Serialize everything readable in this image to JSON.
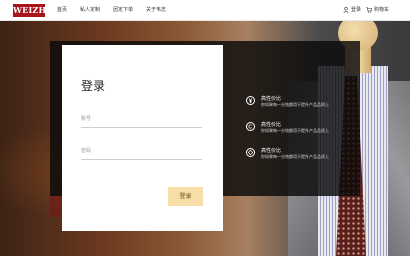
{
  "brand": {
    "logo_text": "WEIZHI"
  },
  "nav": {
    "items": [
      {
        "label": "首页"
      },
      {
        "label": "私人定制"
      },
      {
        "label": "团定下单"
      },
      {
        "label": "关于韦志"
      }
    ],
    "login": "登录",
    "cart": "购物车"
  },
  "login_form": {
    "title": "登录",
    "account_label": "账号",
    "password_label": "密码",
    "submit": "登录"
  },
  "features": [
    {
      "icon": "yen-circle-icon",
      "title": "高性价比",
      "desc": "你如果每一分钱都用于提升产品品质上"
    },
    {
      "icon": "copyright-circle-icon",
      "title": "高性价比",
      "desc": "你如果每一分钱都用于提升产品品质上"
    },
    {
      "icon": "diamond-circle-icon",
      "title": "高性价比",
      "desc": "你如果每一分钱都用于提升产品品质上"
    }
  ],
  "colors": {
    "brand_red": "#a8141c",
    "button_bg": "#f7dda6"
  }
}
